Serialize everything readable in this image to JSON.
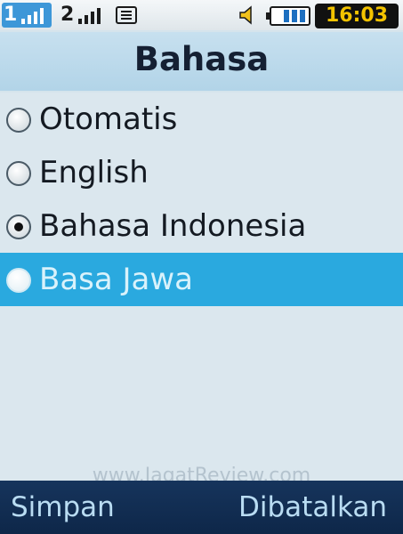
{
  "status": {
    "sim1_label": "1",
    "sim2_label": "2",
    "time": "16:03"
  },
  "header": {
    "title": "Bahasa"
  },
  "languages": [
    {
      "label": "Otomatis",
      "checked": false,
      "highlighted": false
    },
    {
      "label": "English",
      "checked": false,
      "highlighted": false
    },
    {
      "label": "Bahasa Indonesia",
      "checked": true,
      "highlighted": false
    },
    {
      "label": "Basa Jawa",
      "checked": false,
      "highlighted": true
    }
  ],
  "watermark": "www.JagatReview.com",
  "softkeys": {
    "left": "Simpan",
    "right": "Dibatalkan"
  },
  "colors": {
    "highlight": "#2aa9df",
    "softkey_bar": "#0e2749",
    "clock_text": "#f3c300",
    "active_sim": "#3d97d8"
  }
}
